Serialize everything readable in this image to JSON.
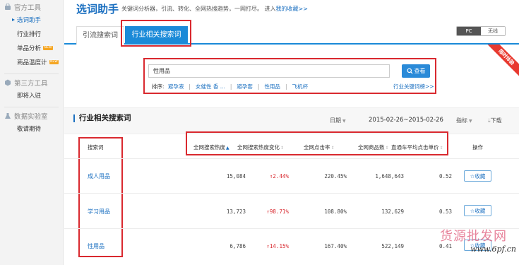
{
  "sidebar": {
    "group1": "官方工具",
    "items1": [
      "选词助手",
      "行业排行",
      "单品分析",
      "商品温度计"
    ],
    "new_badge": "NEW",
    "group2": "第三方工具",
    "items2": [
      "即将入驻"
    ],
    "group3": "数据实验室",
    "items3": [
      "敬请期待"
    ]
  },
  "header": {
    "title": "选词助手",
    "desc": "关键词分析器，引流、转化、全网热搜趋势，一网打尽。 进入",
    "desc_link": "我的收藏>>"
  },
  "tabs": [
    "引流搜索词",
    "行业相关搜索词"
  ],
  "device": {
    "pc": "PC",
    "wireless": "无线"
  },
  "ribbon": "限时体验",
  "search": {
    "value": "性用品",
    "button": "查看",
    "sort_label": "排序:",
    "sort_items": [
      "避孕液",
      "女催性 香 ...",
      "避孕套",
      "性用品",
      "飞机杯"
    ],
    "industry_link": "行业关键词榜>>"
  },
  "section": {
    "title": "行业相关搜索词",
    "date_label": "日期",
    "date_range": "2015-02-26~2015-02-26",
    "metric_label": "指标",
    "download": "下载"
  },
  "table": {
    "headers": [
      "搜索词",
      "全网搜索热度",
      "全网搜索热度变化",
      "全网点击率",
      "全网商品数",
      "直通车平均点击单价",
      "操作"
    ],
    "fav_label": "收藏",
    "rows": [
      {
        "keyword": "成人用品",
        "heat": "15,084",
        "change": "2.44%",
        "ctr": "220.45%",
        "count": "1,648,643",
        "cpc": "0.52"
      },
      {
        "keyword": "学习用品",
        "heat": "13,723",
        "change": "98.71%",
        "ctr": "108.80%",
        "count": "132,629",
        "cpc": "0.53"
      },
      {
        "keyword": "性用品",
        "heat": "6,786",
        "change": "14.15%",
        "ctr": "167.40%",
        "count": "522,149",
        "cpc": "0.41"
      }
    ]
  },
  "watermark": {
    "text": "货源批发网",
    "url": "www.6pf.cn"
  },
  "colors": {
    "brand_blue": "#1a8ad8",
    "link_blue": "#1a6fc0",
    "highlight_red": "#d9292f",
    "ribbon_red": "#e8392f"
  }
}
